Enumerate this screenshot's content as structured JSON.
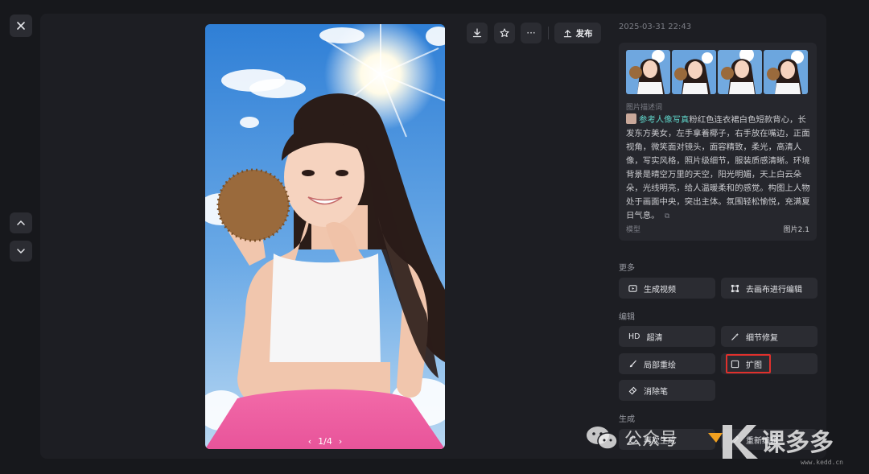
{
  "viewer": {
    "pager_text": "1/4"
  },
  "toolbar": {
    "publish_label": "发布"
  },
  "info": {
    "timestamp": "2025-03-31 22:43",
    "description_label": "图片描述词",
    "reference_tag": "参考人像写真",
    "description": "粉红色连衣裙白色短款背心，长发东方美女，左手拿着椰子，右手放在嘴边，正面视角，微笑面对镜头，面容精致，柔光，高清人像，写实风格，照片级细节，服装质感清晰。环境背景是晴空万里的天空，阳光明媚，天上白云朵朵，光线明亮，给人温暖柔和的感觉。构图上人物处于画面中央，突出主体。氛围轻松愉悦，充满夏日气息。",
    "model_label": "模型",
    "model_value": "图片2.1"
  },
  "sections": {
    "more": "更多",
    "edit": "编辑",
    "generate": "生成"
  },
  "actions": {
    "generate_video": "生成视频",
    "canvas_edit": "去画布进行编辑",
    "hd_badge": "HD",
    "hd": "超清",
    "detail_repair": "细节修复",
    "partial_redraw": "局部重绘",
    "expand": "扩图",
    "eraser": "消除笔",
    "regenerate": "再次生成",
    "regenerate_2": "重新编辑"
  },
  "watermark": {
    "wechat_text": "公众号",
    "brand": "课多多",
    "url": "www.kedd.cn"
  },
  "colors": {
    "background": "#17181c",
    "panel": "#1d1e23",
    "button": "#2b2c32",
    "accent_tag": "#5fd3c8",
    "highlight": "#e0302c"
  }
}
